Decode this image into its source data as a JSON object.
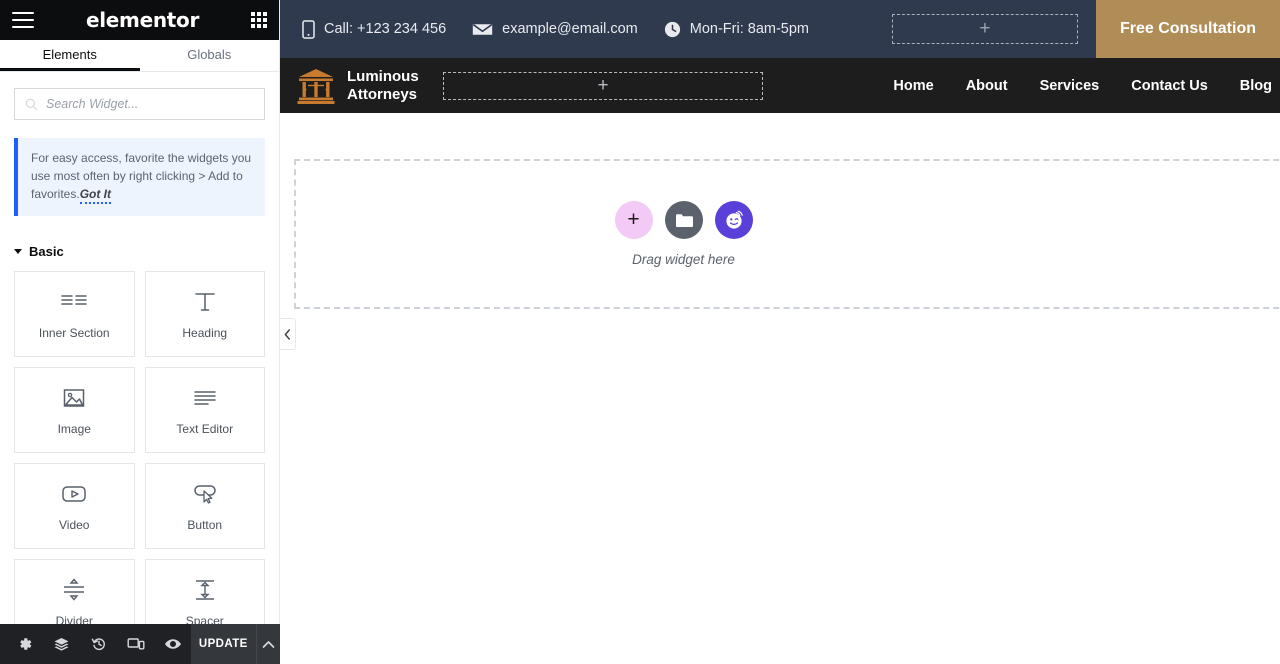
{
  "panel": {
    "logo_text": "elementor",
    "menu_icon": "hamburger-icon",
    "apps_icon": "apps-grid-icon",
    "tabs": [
      {
        "label": "Elements",
        "active": true
      },
      {
        "label": "Globals",
        "active": false
      }
    ],
    "search": {
      "placeholder": "Search Widget...",
      "value": ""
    },
    "notice": {
      "text": "For easy access, favorite the widgets you use most often by right clicking > Add to favorites.",
      "link": "Got It"
    },
    "category": {
      "label": "Basic",
      "expanded": true
    },
    "widgets": [
      {
        "label": "Inner Section",
        "icon": "inner-section-icon"
      },
      {
        "label": "Heading",
        "icon": "heading-icon"
      },
      {
        "label": "Image",
        "icon": "image-icon"
      },
      {
        "label": "Text Editor",
        "icon": "text-editor-icon"
      },
      {
        "label": "Video",
        "icon": "video-icon"
      },
      {
        "label": "Button",
        "icon": "button-icon"
      },
      {
        "label": "Divider",
        "icon": "divider-icon"
      },
      {
        "label": "Spacer",
        "icon": "spacer-icon"
      }
    ],
    "bottom_bar": {
      "update_label": "UPDATE",
      "icons": [
        "settings-gear-icon",
        "navigator-layers-icon",
        "history-icon",
        "responsive-mode-icon",
        "preview-eye-icon"
      ],
      "caret": "chevron-up-icon"
    },
    "collapse_handle": "chevron-left-icon"
  },
  "canvas": {
    "topbar": {
      "contacts": [
        {
          "icon": "mobile-phone-icon",
          "text": "Call: +123 234 456"
        },
        {
          "icon": "envelope-icon",
          "text": "example@email.com"
        },
        {
          "icon": "clock-icon",
          "text": "Mon-Fri: 8am-5pm"
        }
      ],
      "empty_column_placeholder": "+",
      "cta_label": "Free Consultation",
      "background_color": "#2f3a4f",
      "cta_color": "#b08d57"
    },
    "navbar": {
      "brand_line1": "Luminous",
      "brand_line2": "Attorneys",
      "logo_icon": "courthouse-scales-icon",
      "logo_color": "#c87a2e",
      "empty_column_placeholder": "+",
      "links": [
        "Home",
        "About",
        "Services",
        "Contact Us",
        "Blog"
      ],
      "background_color": "#1d1d1d"
    },
    "dropzone": {
      "label": "Drag widget here",
      "buttons": [
        {
          "icon": "plus-icon",
          "name": "add-element-button",
          "color": "#f3c9f6"
        },
        {
          "icon": "folder-icon",
          "name": "template-library-button",
          "color": "#5b626d"
        },
        {
          "icon": "ai-face-icon",
          "name": "ai-button",
          "color": "#5b3fd9"
        }
      ]
    }
  }
}
